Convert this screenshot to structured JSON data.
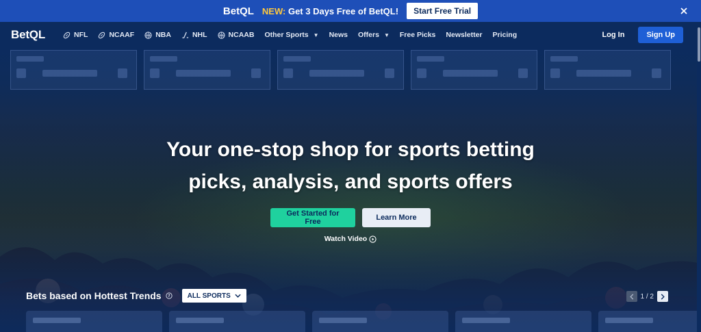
{
  "promo": {
    "brand": "BetQL",
    "highlight": "NEW:",
    "message": "Get 3 Days Free of BetQL!",
    "cta": "Start Free Trial"
  },
  "nav": {
    "logo": "BetQL",
    "items": [
      {
        "label": "NFL",
        "icon": "football-icon"
      },
      {
        "label": "NCAAF",
        "icon": "football-icon"
      },
      {
        "label": "NBA",
        "icon": "basketball-icon"
      },
      {
        "label": "NHL",
        "icon": "hockey-stick-icon"
      },
      {
        "label": "NCAAB",
        "icon": "basketball-icon"
      },
      {
        "label": "Other Sports",
        "icon": "caret-down-icon"
      },
      {
        "label": "News"
      },
      {
        "label": "Offers",
        "icon": "caret-down-icon"
      },
      {
        "label": "Free Picks"
      },
      {
        "label": "Newsletter"
      },
      {
        "label": "Pricing"
      }
    ],
    "login": "Log In",
    "signup": "Sign Up"
  },
  "hero": {
    "headline_line1": "Your one-stop shop for sports betting",
    "headline_line2": "picks, analysis, and sports offers",
    "primary_cta": "Get Started for Free",
    "secondary_cta": "Learn More",
    "watch_video": "Watch Video"
  },
  "trends": {
    "title": "Bets based on Hottest Trends",
    "filter": "ALL SPORTS",
    "pager": "1 / 2"
  },
  "colors": {
    "navy": "#0c2b5e",
    "promo_blue": "#1e4fb8",
    "accent_green": "#1fd19e",
    "signup_blue": "#1e5fd6",
    "yellow": "#ffc83d"
  }
}
